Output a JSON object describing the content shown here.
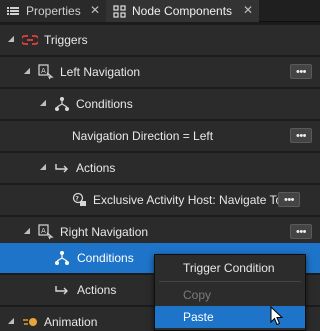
{
  "tabs": [
    {
      "label": "Properties",
      "active": false
    },
    {
      "label": "Node Components",
      "active": true
    }
  ],
  "tree": {
    "rows": [
      {
        "label": "Triggers",
        "icon": "trigger-icon"
      },
      {
        "label": "Left Navigation",
        "icon": "navigation-icon"
      },
      {
        "label": "Conditions",
        "icon": "conditions-icon"
      },
      {
        "label": "Navigation Direction = Left",
        "icon": ""
      },
      {
        "label": "Actions",
        "icon": "actions-icon"
      },
      {
        "label": "Exclusive Activity Host: Navigate To",
        "icon": "activity-host-icon"
      },
      {
        "label": "Right Navigation",
        "icon": "navigation-icon"
      },
      {
        "label": "Conditions",
        "icon": "conditions-icon",
        "selected": true
      },
      {
        "label": "Actions",
        "icon": "actions-icon"
      },
      {
        "label": "Animation",
        "icon": "animation-icon"
      }
    ],
    "more_button_label": "•••"
  },
  "context_menu": {
    "items": [
      {
        "label": "Trigger Condition",
        "enabled": true
      },
      {
        "label": "Copy",
        "enabled": false
      },
      {
        "label": "Paste",
        "enabled": true,
        "highlighted": true
      }
    ]
  },
  "colors": {
    "selection": "#1e74c9",
    "row_bg": "#2b2b2b",
    "trigger_accent": "#e0433a",
    "animation_accent": "#e8a53a"
  }
}
